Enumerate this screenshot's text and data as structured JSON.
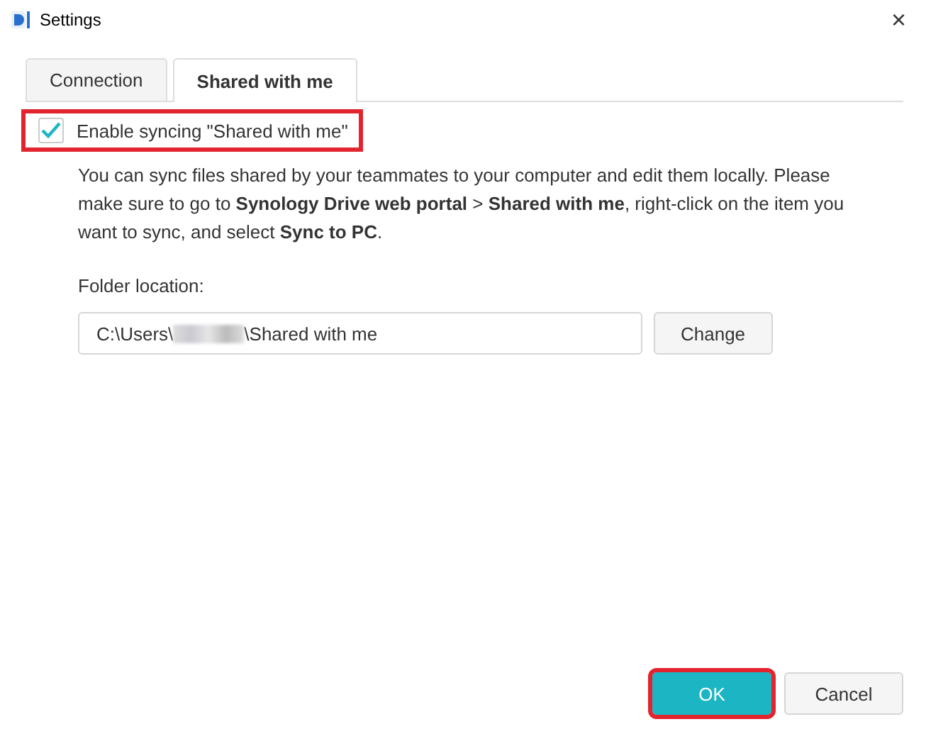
{
  "window": {
    "title": "Settings",
    "close": "×"
  },
  "tabs": [
    {
      "label": "Connection",
      "selected": false
    },
    {
      "label": "Shared with me",
      "selected": true
    }
  ],
  "enable_sync": {
    "label": "Enable syncing \"Shared with me\"",
    "checked": true,
    "highlighted": true
  },
  "description": "You can sync files shared by your teammates to your computer and edit them locally. Please make sure to go to **Synology Drive web portal** > **Shared with me**, right-click on the item you want to sync, and select **Sync to PC**.",
  "folder": {
    "label": "Folder location:",
    "value_start": "C:\\Users\\",
    "value_end": "\\Shared with me",
    "redacted": true,
    "button": "Change"
  },
  "buttons": [
    {
      "label": "OK",
      "kind": "primary",
      "highlighted": true
    },
    {
      "label": "Cancel",
      "kind": "secondary",
      "highlighted": false
    }
  ]
}
